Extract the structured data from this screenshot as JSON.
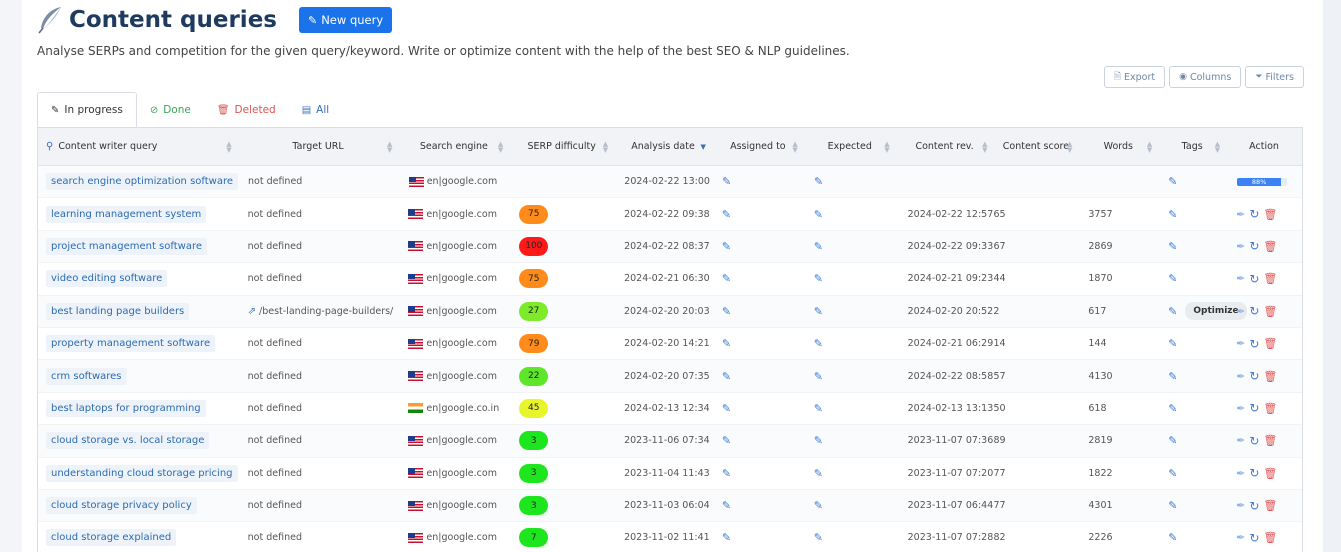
{
  "header": {
    "title": "Content queries",
    "new_query_label": "New query"
  },
  "subtitle": "Analyse SERPs and competition for the given query/keyword. Write or optimize content with the help of the best SEO & NLP guidelines.",
  "toolbar": {
    "export_label": "Export",
    "columns_label": "Columns",
    "filters_label": "Filters"
  },
  "tabs": [
    {
      "label": "In progress",
      "icon": "pencil-icon"
    },
    {
      "label": "Done",
      "icon": "check-circle-icon"
    },
    {
      "label": "Deleted",
      "icon": "trash-icon"
    },
    {
      "label": "All",
      "icon": "list-icon"
    }
  ],
  "columns": [
    "Content writer query",
    "Target URL",
    "Search engine",
    "SERP difficulty",
    "Analysis date",
    "Assigned to",
    "Expected",
    "Content rev.",
    "Content score",
    "Words",
    "Tags",
    "Action"
  ],
  "optimize_label": "Optimize",
  "colors": {
    "accent": "#1a73e8",
    "title": "#1e3a5f",
    "link": "#2d6bb0"
  },
  "rows": [
    {
      "query": "search engine optimization software",
      "url": "not defined",
      "flag": "us",
      "engine": "en|google.com",
      "difficulty": "",
      "difficulty_color": "",
      "date": "2024-02-22 13:00",
      "rev": "",
      "score": "",
      "words": "",
      "progress": 88,
      "progress_label": "88%"
    },
    {
      "query": "learning management system",
      "url": "not defined",
      "flag": "us",
      "engine": "en|google.com",
      "difficulty": "75",
      "difficulty_color": "#ff8c1a",
      "date": "2024-02-22 09:38",
      "rev": "2024-02-22 12:57",
      "score": "65",
      "words": "3757"
    },
    {
      "query": "project management software",
      "url": "not defined",
      "flag": "us",
      "engine": "en|google.com",
      "difficulty": "100",
      "difficulty_color": "#ff1a1a",
      "date": "2024-02-22 08:37",
      "rev": "2024-02-22 09:33",
      "score": "67",
      "words": "2869"
    },
    {
      "query": "video editing software",
      "url": "not defined",
      "flag": "us",
      "engine": "en|google.com",
      "difficulty": "75",
      "difficulty_color": "#ff8c1a",
      "date": "2024-02-21 06:30",
      "rev": "2024-02-21 09:23",
      "score": "44",
      "words": "1870"
    },
    {
      "query": "best landing page builders",
      "url": "/best-landing-page-builders/",
      "flag": "us",
      "engine": "en|google.com",
      "difficulty": "27",
      "difficulty_color": "#7dea2a",
      "date": "2024-02-20 20:03",
      "rev": "2024-02-20 20:52",
      "score": "2",
      "words": "617",
      "optimize": true
    },
    {
      "query": "property management software",
      "url": "not defined",
      "flag": "us",
      "engine": "en|google.com",
      "difficulty": "79",
      "difficulty_color": "#ff8c1a",
      "date": "2024-02-20 14:21",
      "rev": "2024-02-21 06:29",
      "score": "14",
      "words": "144"
    },
    {
      "query": "crm softwares",
      "url": "not defined",
      "flag": "us",
      "engine": "en|google.com",
      "difficulty": "22",
      "difficulty_color": "#5ee62a",
      "date": "2024-02-20 07:35",
      "rev": "2024-02-22 08:58",
      "score": "57",
      "words": "4130"
    },
    {
      "query": "best laptops for programming",
      "url": "not defined",
      "flag": "in",
      "engine": "en|google.co.in",
      "difficulty": "45",
      "difficulty_color": "#e8f52a",
      "date": "2024-02-13 12:34",
      "rev": "2024-02-13 13:13",
      "score": "50",
      "words": "618"
    },
    {
      "query": "cloud storage vs. local storage",
      "url": "not defined",
      "flag": "us",
      "engine": "en|google.com",
      "difficulty": "3",
      "difficulty_color": "#1ee61e",
      "date": "2023-11-06 07:34",
      "rev": "2023-11-07 07:36",
      "score": "89",
      "words": "2819"
    },
    {
      "query": "understanding cloud storage pricing",
      "url": "not defined",
      "flag": "us",
      "engine": "en|google.com",
      "difficulty": "3",
      "difficulty_color": "#1ee61e",
      "date": "2023-11-04 11:43",
      "rev": "2023-11-07 07:20",
      "score": "77",
      "words": "1822"
    },
    {
      "query": "cloud storage privacy policy",
      "url": "not defined",
      "flag": "us",
      "engine": "en|google.com",
      "difficulty": "3",
      "difficulty_color": "#1ee61e",
      "date": "2023-11-03 06:04",
      "rev": "2023-11-07 06:44",
      "score": "77",
      "words": "4301"
    },
    {
      "query": "cloud storage explained",
      "url": "not defined",
      "flag": "us",
      "engine": "en|google.com",
      "difficulty": "7",
      "difficulty_color": "#1ee61e",
      "date": "2023-11-02 11:41",
      "rev": "2023-11-07 07:28",
      "score": "82",
      "words": "2226"
    }
  ]
}
